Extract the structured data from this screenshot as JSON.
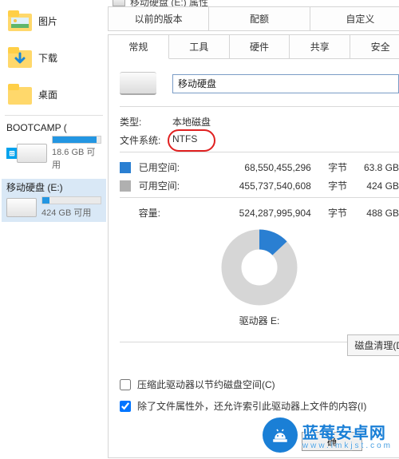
{
  "sidebar": {
    "folders": [
      {
        "label": "图片"
      },
      {
        "label": "下载"
      },
      {
        "label": "桌面"
      }
    ],
    "drives": {
      "bootcamp": {
        "title": "BOOTCAMP (",
        "sub": "18.6 GB 可用",
        "fill_pct": 92
      },
      "mobile": {
        "title": "移动硬盘 (E:)",
        "sub": "424 GB 可用",
        "fill_pct": 13
      }
    }
  },
  "dialog": {
    "title": "移动硬盘 (E:) 属性",
    "tabs_top": [
      "以前的版本",
      "配额",
      "自定义"
    ],
    "tabs_bot": [
      "常规",
      "工具",
      "硬件",
      "共享",
      "安全"
    ],
    "name_value": "移动硬盘",
    "type": {
      "label": "类型:",
      "value": "本地磁盘"
    },
    "fs": {
      "label": "文件系统:",
      "value": "NTFS"
    },
    "used": {
      "label": "已用空间:",
      "bytes": "68,550,455,296",
      "unit": "字节",
      "human": "63.8 GB"
    },
    "free": {
      "label": "可用空间:",
      "bytes": "455,737,540,608",
      "unit": "字节",
      "human": "424 GB"
    },
    "cap": {
      "label": "容量:",
      "bytes": "524,287,995,904",
      "unit": "字节",
      "human": "488 GB"
    },
    "drive_letter": "驱动器 E:",
    "cleanup": "磁盘清理(D)",
    "chk_compress": "压缩此驱动器以节约磁盘空间(C)",
    "chk_index": "除了文件属性外，还允许索引此驱动器上文件的内容(I)",
    "ok": "确",
    "used_pct": 13
  },
  "watermark": {
    "brand": "蓝莓安卓网",
    "sub": "www.lmkjst.com"
  }
}
